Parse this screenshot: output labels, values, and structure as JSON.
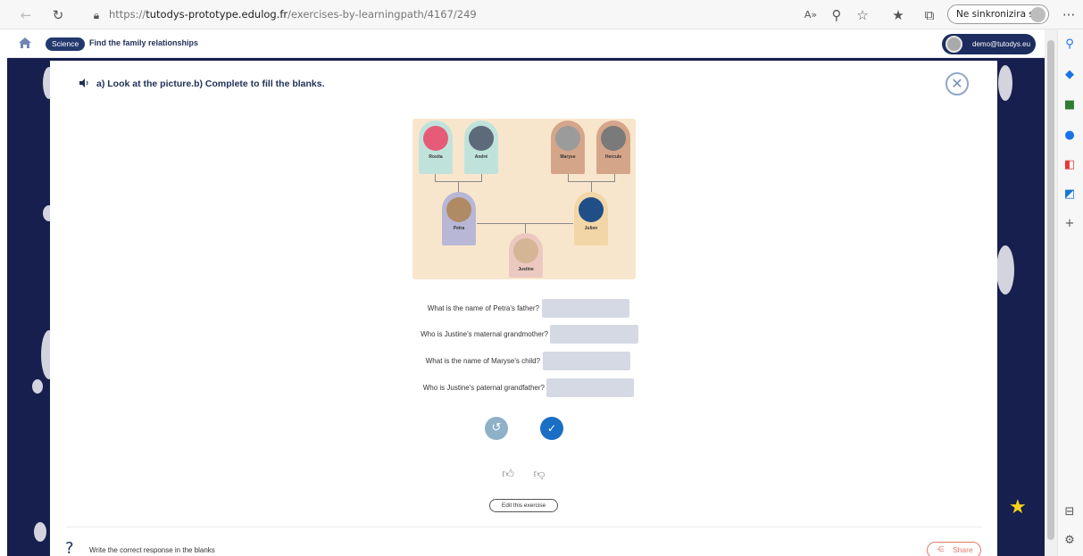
{
  "browser": {
    "url_prefix": "https://",
    "url_domain": "tutodys-prototype.edulog.fr",
    "url_path": "/exercises-by-learningpath/4167/249",
    "sync_label": "Ne sinkronizira se",
    "more_label": "···"
  },
  "header": {
    "subject": "Science",
    "title": "Find the family relationships",
    "user": "demo@tutodys.eu ▾"
  },
  "exercise": {
    "instruction": "a) Look at the picture.b) Complete to fill the blanks."
  },
  "tree": {
    "people": [
      {
        "name": "Rosita",
        "color": "#bfe3db",
        "photo": "#e65b77"
      },
      {
        "name": "André",
        "color": "#bfe3db",
        "photo": "#5d6a7a"
      },
      {
        "name": "Maryse",
        "color": "#d5a58a",
        "photo": "#9b9b9b"
      },
      {
        "name": "Hercule",
        "color": "#d5a58a",
        "photo": "#7a7a7a"
      },
      {
        "name": "Petra",
        "color": "#b8b7d6",
        "photo": "#b08a64"
      },
      {
        "name": "Julien",
        "color": "#f3d6a8",
        "photo": "#1f4f86"
      },
      {
        "name": "Justine",
        "color": "#ebc9c0",
        "photo": "#d4b595"
      }
    ]
  },
  "questions": [
    {
      "text": "What is the name of Petra's father?",
      "value": ""
    },
    {
      "text": "Who is Justine's maternal grandmother?",
      "value": ""
    },
    {
      "text": "What is the name of Maryse's child?",
      "value": ""
    },
    {
      "text": "Who is Justine's paternal grandfather?",
      "value": ""
    }
  ],
  "actions": {
    "edit_label": "Edit this exercise",
    "help_text": "Write the correct response in the blanks",
    "share_label": "Share",
    "help_symbol": "?"
  },
  "colors": {
    "brand_dark": "#161f4d",
    "primary": "#1a6fc4",
    "share": "#e07b6b"
  }
}
